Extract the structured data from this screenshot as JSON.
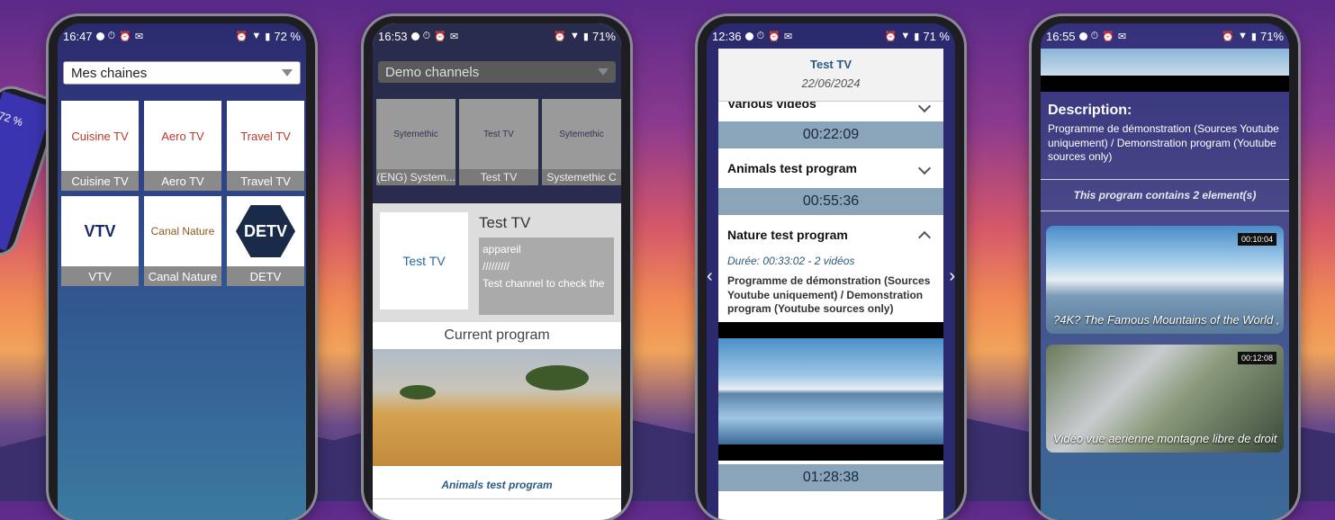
{
  "phone1": {
    "status": {
      "time": "16:47",
      "battery": "72 %"
    },
    "select_label": "Mes chaines",
    "channels": [
      {
        "name": "Cuisine TV",
        "logo": "Cuisine TV"
      },
      {
        "name": "Aero TV",
        "logo": "Aero TV"
      },
      {
        "name": "Travel TV",
        "logo": "Travel TV"
      },
      {
        "name": "VTV",
        "logo": "VTV"
      },
      {
        "name": "Canal Nature",
        "logo": "Canal Nature"
      },
      {
        "name": "DETV",
        "logo": "DETV"
      }
    ]
  },
  "phone2": {
    "status": {
      "time": "16:53",
      "battery": "71%"
    },
    "select_label": "Demo channels",
    "channels": [
      {
        "name": "(ENG) System...",
        "logo": "Sytemethic"
      },
      {
        "name": "Test TV",
        "logo": "Test TV"
      },
      {
        "name": "Systemethic C",
        "logo": "Sytemethic"
      }
    ],
    "channel_title": "Test TV",
    "channel_logo": "Test TV",
    "channel_text": [
      "appareil",
      "/////////",
      "Test channel to check the"
    ],
    "current_program_label": "Current program",
    "program_name": "Animals test program"
  },
  "phone3": {
    "status": {
      "time": "12:36",
      "battery": "71 %"
    },
    "channel": "Test TV",
    "date": "22/06/2024",
    "programs": [
      {
        "name": "Various videos",
        "duration": "00:22:09"
      },
      {
        "name": "Animals test program",
        "duration": "00:55:36"
      },
      {
        "name": "Nature test program",
        "duration": "01:28:38"
      }
    ],
    "expanded_meta": "Durée: 00:33:02 - 2 vidéos",
    "expanded_desc": "Programme de démonstration (Sources Youtube uniquement) / Demonstration program (Youtube sources only)"
  },
  "phone4": {
    "status": {
      "time": "16:55",
      "battery": "71%"
    },
    "description_title": "Description:",
    "description_text": "Programme de démonstration (Sources Youtube uniquement) / Demonstration program (Youtube sources only)",
    "count_text": "This program contains 2 element(s)",
    "videos": [
      {
        "title": "?4K? The Famous Mountains of the World ,",
        "duration": "00:10:04"
      },
      {
        "title": "Vidéo vue aerienne montagne libre de droit",
        "duration": "00:12:08"
      }
    ]
  },
  "left_phone_battery": "72 %"
}
